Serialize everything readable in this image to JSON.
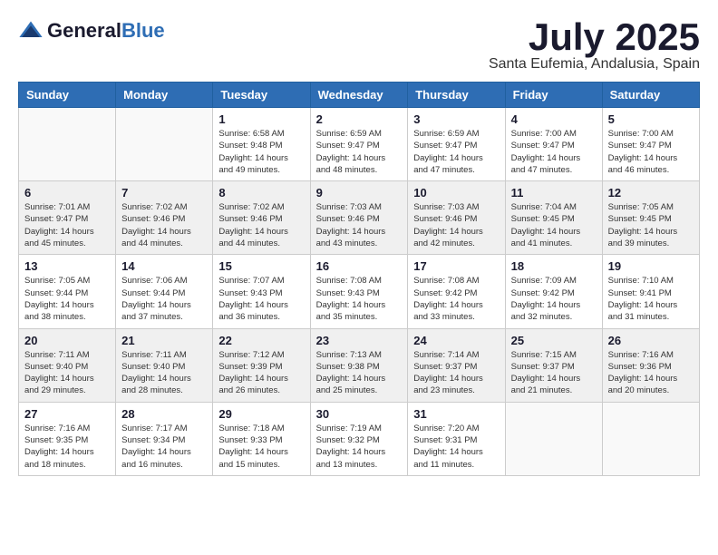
{
  "logo": {
    "general": "General",
    "blue": "Blue"
  },
  "header": {
    "month": "July 2025",
    "location": "Santa Eufemia, Andalusia, Spain"
  },
  "weekdays": [
    "Sunday",
    "Monday",
    "Tuesday",
    "Wednesday",
    "Thursday",
    "Friday",
    "Saturday"
  ],
  "weeks": [
    [
      {
        "day": "",
        "info": ""
      },
      {
        "day": "",
        "info": ""
      },
      {
        "day": "1",
        "info": "Sunrise: 6:58 AM\nSunset: 9:48 PM\nDaylight: 14 hours and 49 minutes."
      },
      {
        "day": "2",
        "info": "Sunrise: 6:59 AM\nSunset: 9:47 PM\nDaylight: 14 hours and 48 minutes."
      },
      {
        "day": "3",
        "info": "Sunrise: 6:59 AM\nSunset: 9:47 PM\nDaylight: 14 hours and 47 minutes."
      },
      {
        "day": "4",
        "info": "Sunrise: 7:00 AM\nSunset: 9:47 PM\nDaylight: 14 hours and 47 minutes."
      },
      {
        "day": "5",
        "info": "Sunrise: 7:00 AM\nSunset: 9:47 PM\nDaylight: 14 hours and 46 minutes."
      }
    ],
    [
      {
        "day": "6",
        "info": "Sunrise: 7:01 AM\nSunset: 9:47 PM\nDaylight: 14 hours and 45 minutes."
      },
      {
        "day": "7",
        "info": "Sunrise: 7:02 AM\nSunset: 9:46 PM\nDaylight: 14 hours and 44 minutes."
      },
      {
        "day": "8",
        "info": "Sunrise: 7:02 AM\nSunset: 9:46 PM\nDaylight: 14 hours and 44 minutes."
      },
      {
        "day": "9",
        "info": "Sunrise: 7:03 AM\nSunset: 9:46 PM\nDaylight: 14 hours and 43 minutes."
      },
      {
        "day": "10",
        "info": "Sunrise: 7:03 AM\nSunset: 9:46 PM\nDaylight: 14 hours and 42 minutes."
      },
      {
        "day": "11",
        "info": "Sunrise: 7:04 AM\nSunset: 9:45 PM\nDaylight: 14 hours and 41 minutes."
      },
      {
        "day": "12",
        "info": "Sunrise: 7:05 AM\nSunset: 9:45 PM\nDaylight: 14 hours and 39 minutes."
      }
    ],
    [
      {
        "day": "13",
        "info": "Sunrise: 7:05 AM\nSunset: 9:44 PM\nDaylight: 14 hours and 38 minutes."
      },
      {
        "day": "14",
        "info": "Sunrise: 7:06 AM\nSunset: 9:44 PM\nDaylight: 14 hours and 37 minutes."
      },
      {
        "day": "15",
        "info": "Sunrise: 7:07 AM\nSunset: 9:43 PM\nDaylight: 14 hours and 36 minutes."
      },
      {
        "day": "16",
        "info": "Sunrise: 7:08 AM\nSunset: 9:43 PM\nDaylight: 14 hours and 35 minutes."
      },
      {
        "day": "17",
        "info": "Sunrise: 7:08 AM\nSunset: 9:42 PM\nDaylight: 14 hours and 33 minutes."
      },
      {
        "day": "18",
        "info": "Sunrise: 7:09 AM\nSunset: 9:42 PM\nDaylight: 14 hours and 32 minutes."
      },
      {
        "day": "19",
        "info": "Sunrise: 7:10 AM\nSunset: 9:41 PM\nDaylight: 14 hours and 31 minutes."
      }
    ],
    [
      {
        "day": "20",
        "info": "Sunrise: 7:11 AM\nSunset: 9:40 PM\nDaylight: 14 hours and 29 minutes."
      },
      {
        "day": "21",
        "info": "Sunrise: 7:11 AM\nSunset: 9:40 PM\nDaylight: 14 hours and 28 minutes."
      },
      {
        "day": "22",
        "info": "Sunrise: 7:12 AM\nSunset: 9:39 PM\nDaylight: 14 hours and 26 minutes."
      },
      {
        "day": "23",
        "info": "Sunrise: 7:13 AM\nSunset: 9:38 PM\nDaylight: 14 hours and 25 minutes."
      },
      {
        "day": "24",
        "info": "Sunrise: 7:14 AM\nSunset: 9:37 PM\nDaylight: 14 hours and 23 minutes."
      },
      {
        "day": "25",
        "info": "Sunrise: 7:15 AM\nSunset: 9:37 PM\nDaylight: 14 hours and 21 minutes."
      },
      {
        "day": "26",
        "info": "Sunrise: 7:16 AM\nSunset: 9:36 PM\nDaylight: 14 hours and 20 minutes."
      }
    ],
    [
      {
        "day": "27",
        "info": "Sunrise: 7:16 AM\nSunset: 9:35 PM\nDaylight: 14 hours and 18 minutes."
      },
      {
        "day": "28",
        "info": "Sunrise: 7:17 AM\nSunset: 9:34 PM\nDaylight: 14 hours and 16 minutes."
      },
      {
        "day": "29",
        "info": "Sunrise: 7:18 AM\nSunset: 9:33 PM\nDaylight: 14 hours and 15 minutes."
      },
      {
        "day": "30",
        "info": "Sunrise: 7:19 AM\nSunset: 9:32 PM\nDaylight: 14 hours and 13 minutes."
      },
      {
        "day": "31",
        "info": "Sunrise: 7:20 AM\nSunset: 9:31 PM\nDaylight: 14 hours and 11 minutes."
      },
      {
        "day": "",
        "info": ""
      },
      {
        "day": "",
        "info": ""
      }
    ]
  ]
}
